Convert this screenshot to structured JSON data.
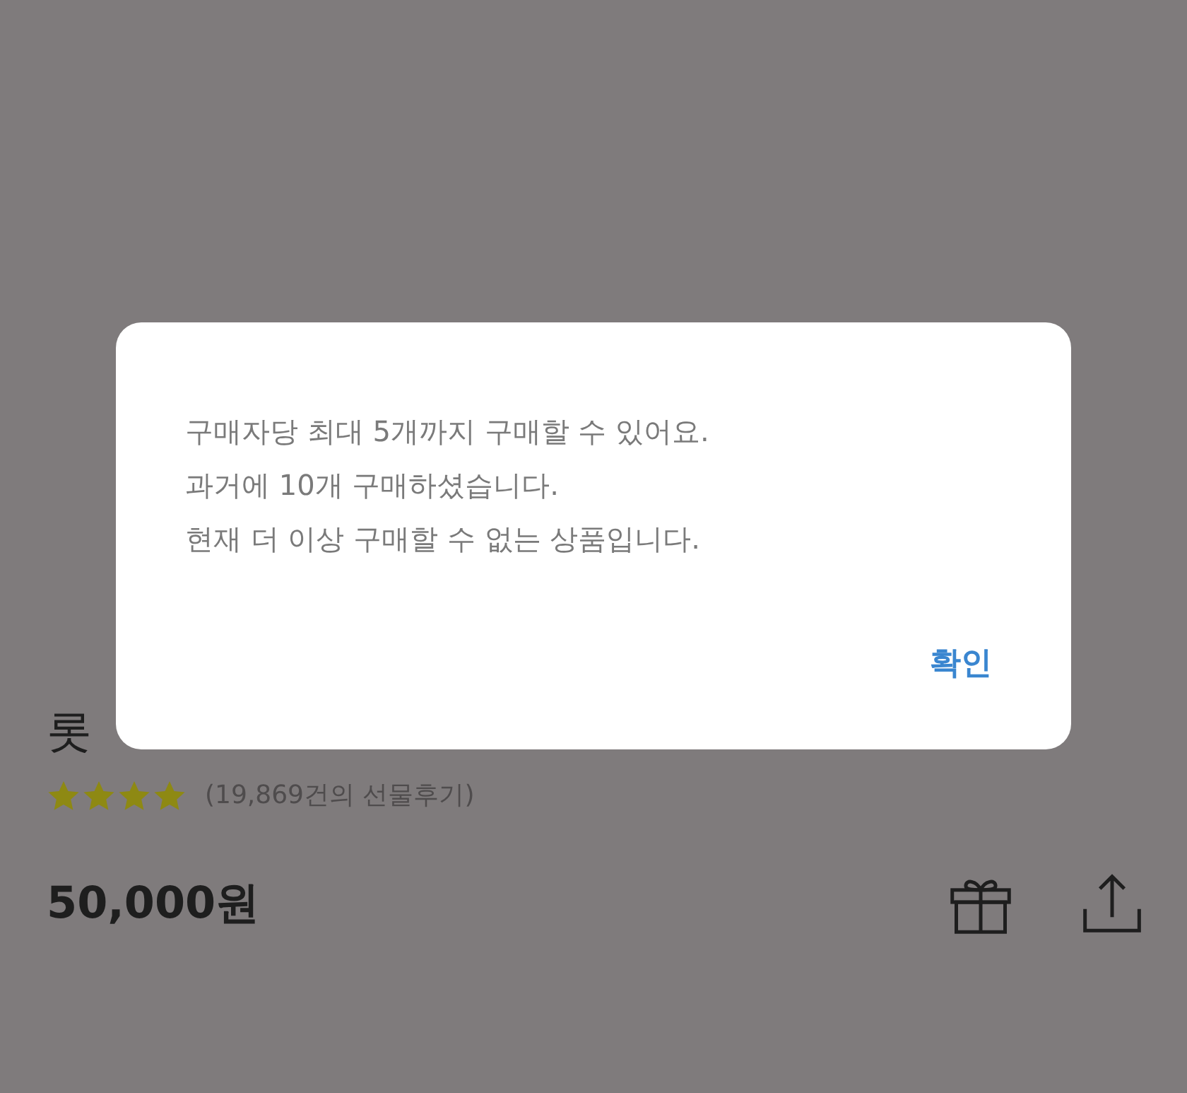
{
  "product": {
    "title": "롯",
    "stars": 4,
    "review_count": "(19,869건의 선물후기)",
    "price": "50,000원"
  },
  "dialog": {
    "lines": [
      "구매자당 최대 5개까지 구매할 수 있어요.",
      "과거에 10개 구매하셨습니다.",
      "현재 더 이상 구매할 수 없는 상품입니다."
    ],
    "button": "확인"
  }
}
